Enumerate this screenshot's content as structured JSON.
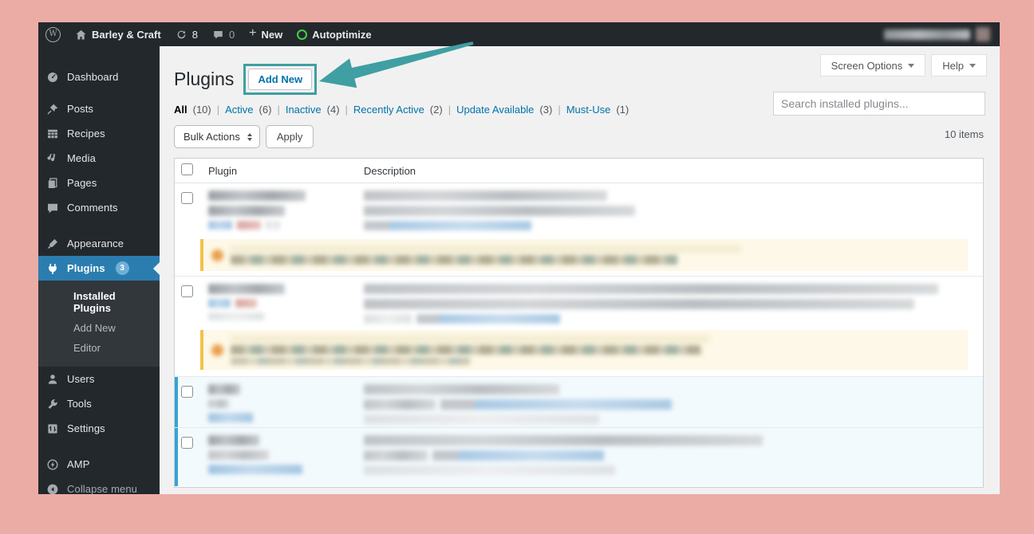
{
  "admin_bar": {
    "site_name": "Barley & Craft",
    "update_count": "8",
    "comment_count": "0",
    "plus": "+",
    "new_label": "New",
    "autoptimize_label": "Autoptimize",
    "wp_logo_letter": "W"
  },
  "sidebar": {
    "dashboard": "Dashboard",
    "posts": "Posts",
    "recipes": "Recipes",
    "media": "Media",
    "pages": "Pages",
    "comments": "Comments",
    "appearance": "Appearance",
    "plugins": "Plugins",
    "plugins_badge": "3",
    "installed_plugins": "Installed Plugins",
    "add_new": "Add New",
    "editor": "Editor",
    "users": "Users",
    "tools": "Tools",
    "settings": "Settings",
    "amp": "AMP",
    "collapse_menu": "Collapse menu"
  },
  "content": {
    "page_title": "Plugins",
    "add_new_button": "Add New",
    "screen_options_label": "Screen Options",
    "help_label": "Help",
    "filter_sep": "|",
    "filters": [
      {
        "label": "All",
        "count": "(10)",
        "current": true
      },
      {
        "label": "Active",
        "count": "(6)",
        "current": false
      },
      {
        "label": "Inactive",
        "count": "(4)",
        "current": false
      },
      {
        "label": "Recently Active",
        "count": "(2)",
        "current": false
      },
      {
        "label": "Update Available",
        "count": "(3)",
        "current": false
      },
      {
        "label": "Must-Use",
        "count": "(1)",
        "current": false
      }
    ],
    "search_placeholder": "Search installed plugins...",
    "bulk_actions_label": "Bulk Actions",
    "apply_label": "Apply",
    "items_count": "10 items",
    "table": {
      "col_plugin": "Plugin",
      "col_description": "Description",
      "rows": [
        {
          "index": 1,
          "state": "inactive",
          "text": "redacted",
          "update_notice": true
        },
        {
          "index": 2,
          "state": "inactive",
          "text": "redacted",
          "update_notice": true
        },
        {
          "index": 3,
          "state": "active",
          "text": "redacted",
          "update_notice": false
        },
        {
          "index": 4,
          "state": "active",
          "text": "redacted",
          "update_notice": false
        }
      ]
    }
  },
  "annotation": {
    "type": "box-and-arrow",
    "target": "Add New button",
    "color": "#3f9fa3"
  }
}
